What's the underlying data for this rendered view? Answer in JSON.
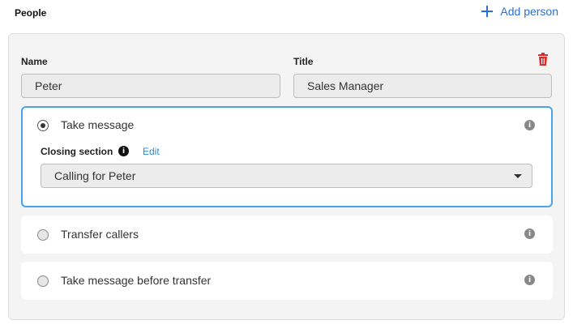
{
  "section": {
    "title": "People"
  },
  "actions": {
    "add_person_label": "Add person",
    "add_icon": "plus-icon"
  },
  "person": {
    "name_label": "Name",
    "name_value": "Peter",
    "title_label": "Title",
    "title_value": "Sales Manager",
    "delete_icon": "trash-icon"
  },
  "options": [
    {
      "label": "Take message",
      "selected": true,
      "closing_section_label": "Closing section",
      "edit_label": "Edit",
      "closing_section_value": "Calling for Peter"
    },
    {
      "label": "Transfer callers",
      "selected": false
    },
    {
      "label": "Take message before transfer",
      "selected": false
    }
  ],
  "colors": {
    "accent": "#2a6fd6",
    "selected_border": "#4aa3e8",
    "delete": "#d32f2f",
    "edit_link": "#2a8bd6"
  }
}
